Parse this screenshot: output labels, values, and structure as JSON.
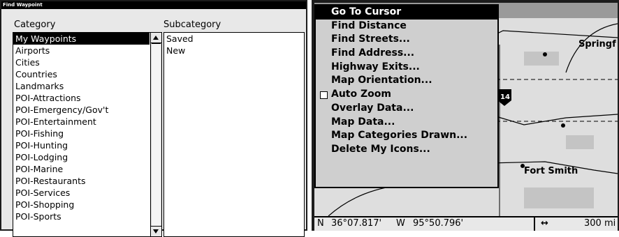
{
  "find_waypoint": {
    "title": "Find Waypoint",
    "category_header": "Category",
    "subcategory_header": "Subcategory",
    "categories": [
      "My Waypoints",
      "Airports",
      "Cities",
      "Countries",
      "Landmarks",
      "POI-Attractions",
      "POI-Emergency/Gov't",
      "POI-Entertainment",
      "POI-Fishing",
      "POI-Hunting",
      "POI-Lodging",
      "POI-Marine",
      "POI-Restaurants",
      "POI-Services",
      "POI-Shopping",
      "POI-Sports"
    ],
    "selected_category": "My Waypoints",
    "subcategories": [
      "Saved",
      "New"
    ]
  },
  "map_menu": {
    "items": [
      "Go To Cursor",
      "Find Distance",
      "Find Streets...",
      "Find Address...",
      "Highway Exits...",
      "Map Orientation...",
      "Auto Zoom",
      "Overlay Data...",
      "Map Data...",
      "Map Categories Drawn...",
      "Delete My Icons..."
    ],
    "highlighted": "Go To Cursor",
    "auto_zoom_checked": false
  },
  "map": {
    "labels": {
      "springfield": "Springf",
      "fort_smith": "Fort Smith",
      "interstate": "14"
    }
  },
  "status_bar": {
    "lat_prefix": "N",
    "lat": "36°07.817'",
    "lon_prefix": "W",
    "lon": "95°50.796'",
    "zoom_icon": "↔",
    "zoom": "300 mi"
  },
  "colors": {
    "highlight": "#000000",
    "menu_bg": "#cfcfcf",
    "list_bg": "#ffffff",
    "panel_bg": "#e8e8e8"
  }
}
